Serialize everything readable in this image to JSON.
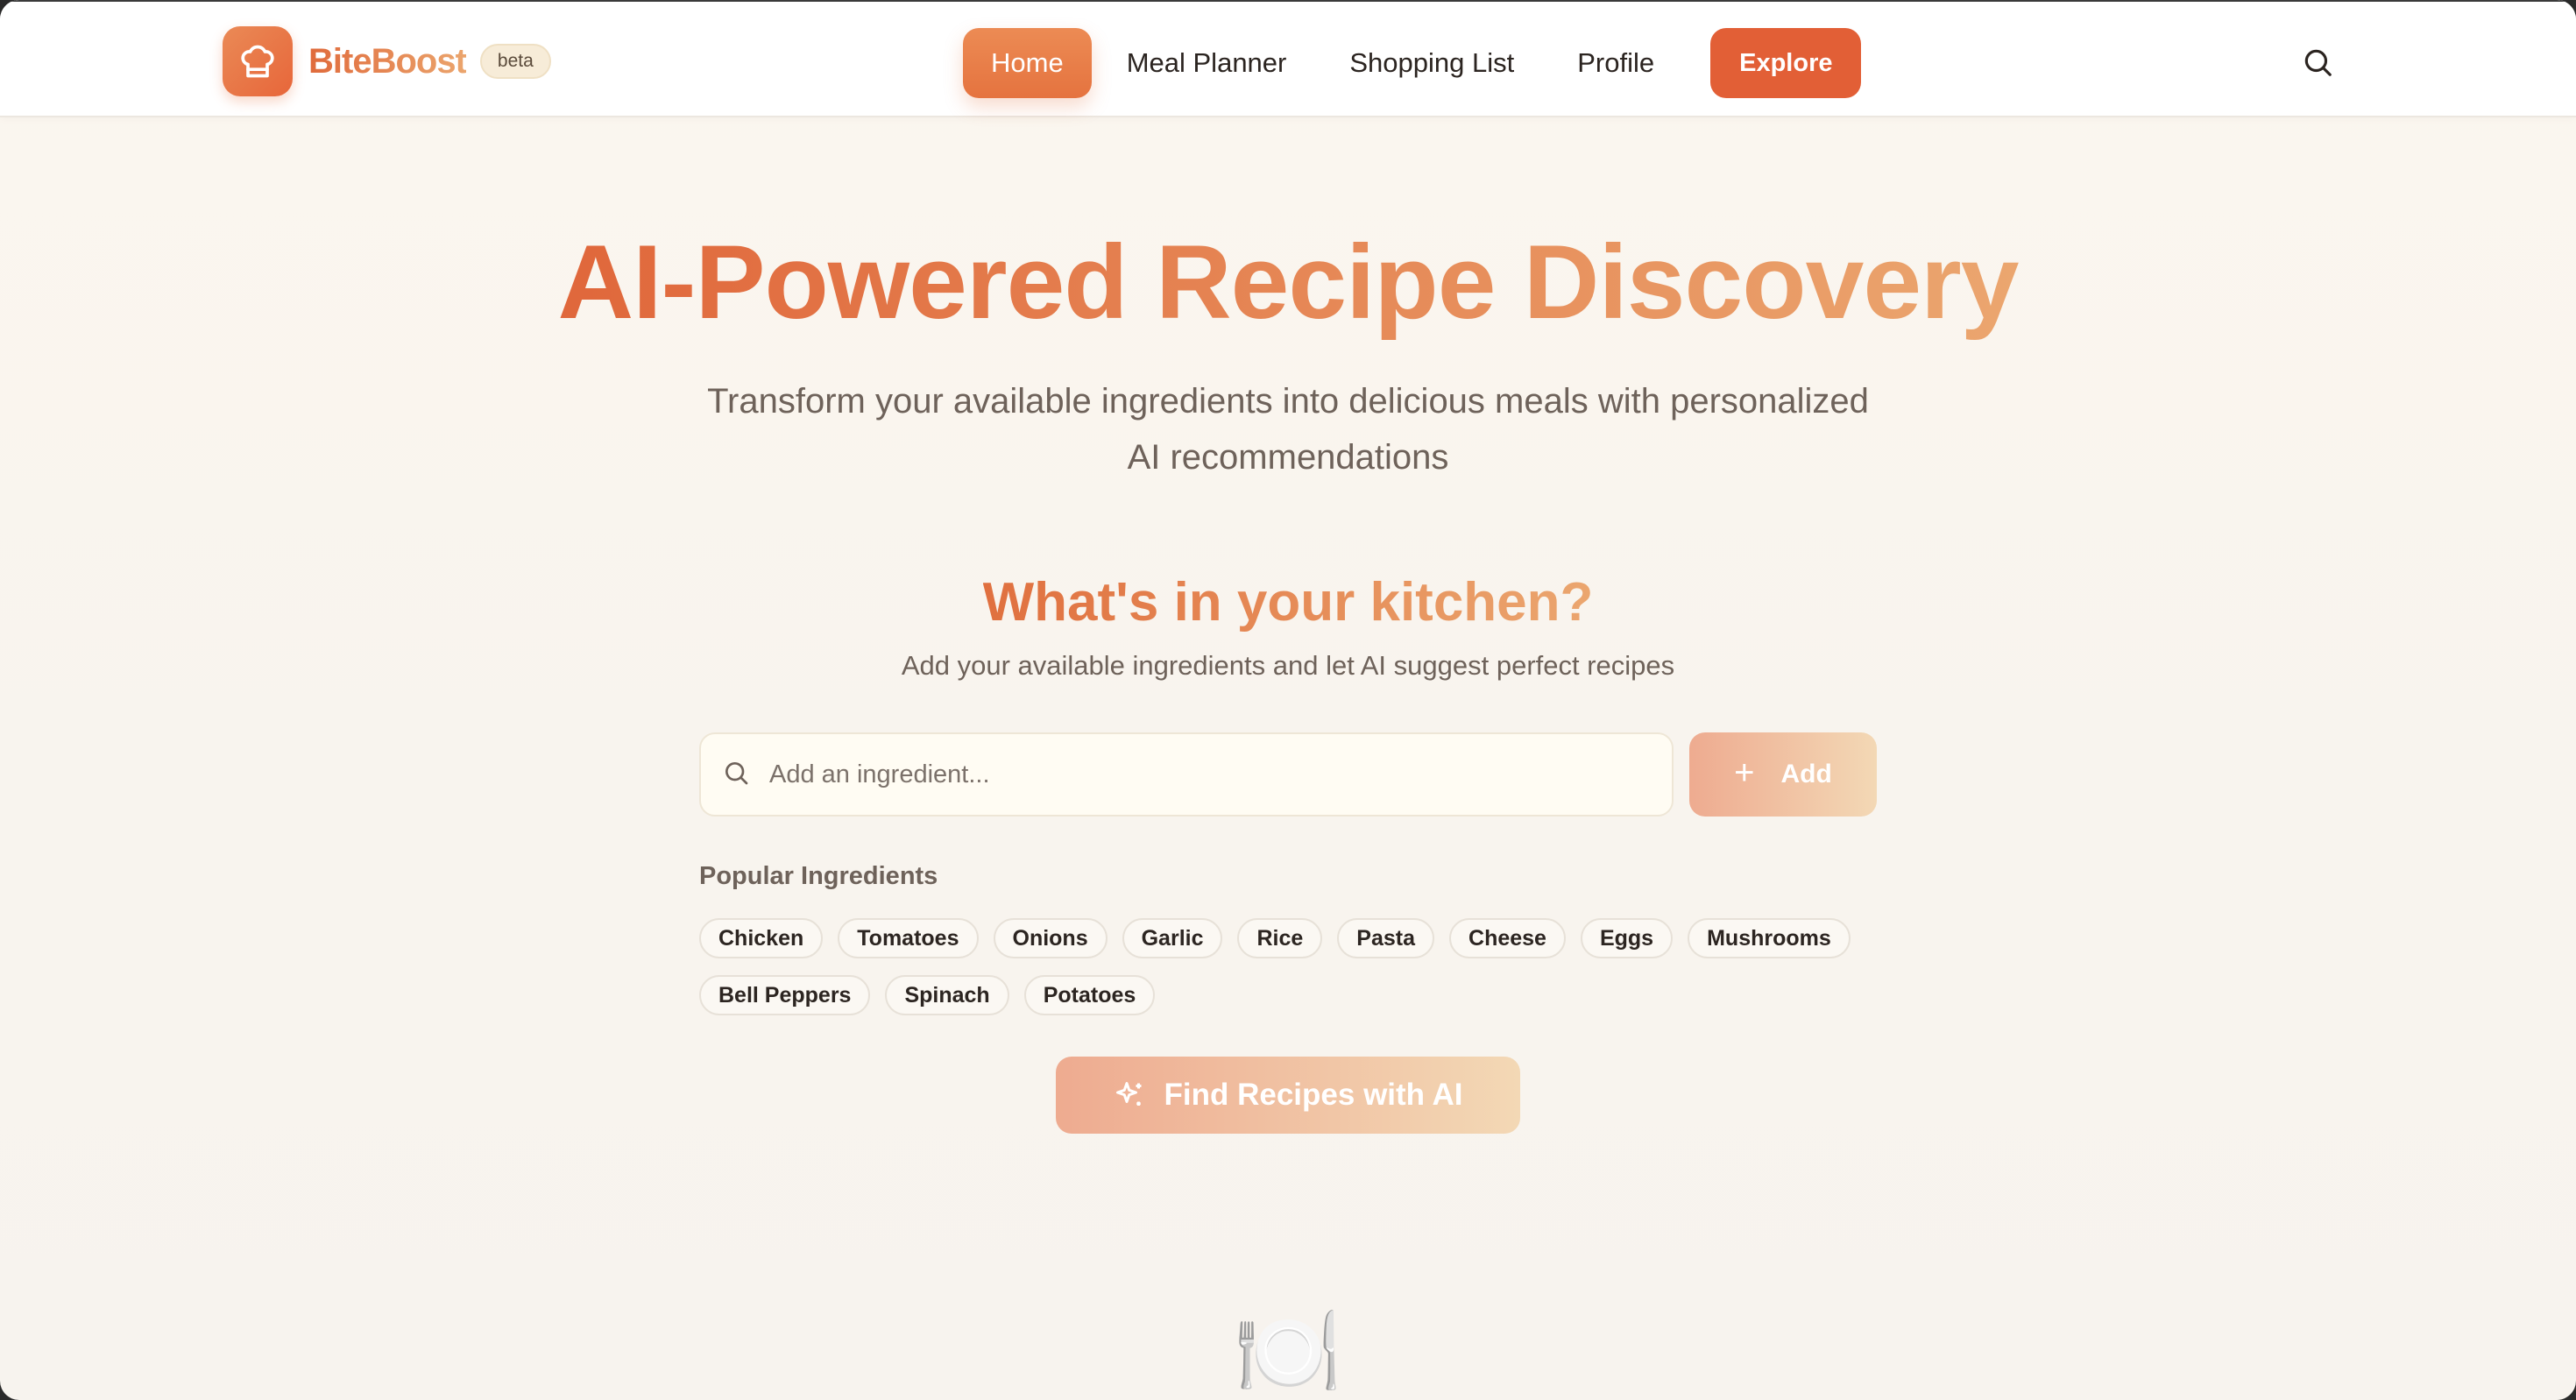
{
  "brand": {
    "name": "BiteBoost",
    "badge": "beta",
    "logo_icon": "chef-hat-icon"
  },
  "nav": {
    "items": [
      {
        "label": "Home",
        "active": true
      },
      {
        "label": "Meal Planner",
        "active": false
      },
      {
        "label": "Shopping List",
        "active": false
      },
      {
        "label": "Profile",
        "active": false
      }
    ],
    "cta": "Explore",
    "search_icon": "search-icon"
  },
  "hero": {
    "title": "AI-Powered Recipe Discovery",
    "subtitle": "Transform your available ingredients into delicious meals with personalized AI recommendations"
  },
  "kitchen": {
    "title": "What's in your kitchen?",
    "subtitle": "Add your available ingredients and let AI suggest perfect recipes",
    "input_placeholder": "Add an ingredient...",
    "add_label": "Add",
    "popular_label": "Popular Ingredients",
    "popular": [
      "Chicken",
      "Tomatoes",
      "Onions",
      "Garlic",
      "Rice",
      "Pasta",
      "Cheese",
      "Eggs",
      "Mushrooms",
      "Bell Peppers",
      "Spinach",
      "Potatoes"
    ],
    "find_label": "Find Recipes with AI",
    "find_icon": "sparkles-icon"
  },
  "empty_state": {
    "icon": "🍽️"
  },
  "colors": {
    "accent": "#e5733f",
    "explore": "#e25f36",
    "background": "#f8f4ee"
  }
}
